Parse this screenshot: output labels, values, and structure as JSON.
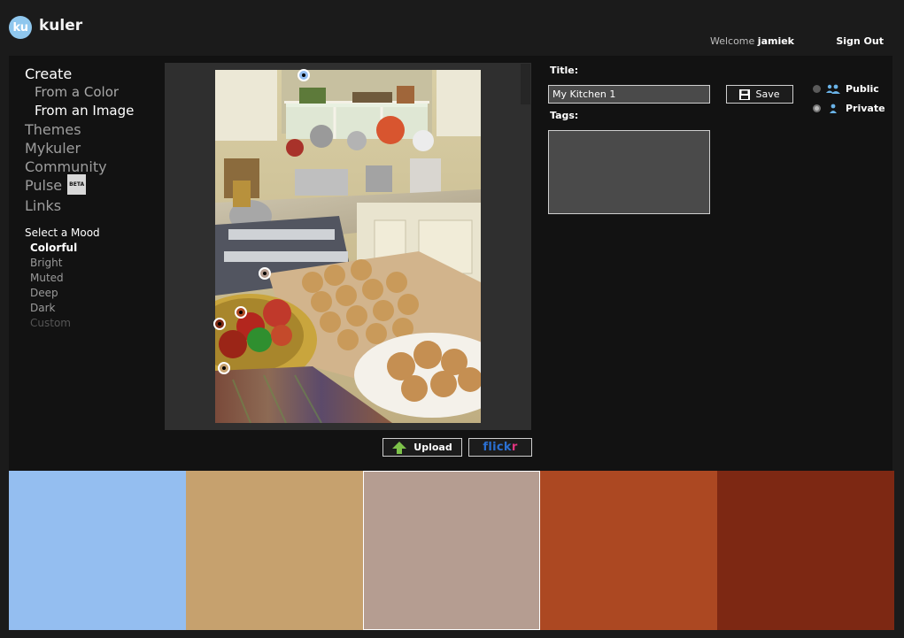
{
  "header": {
    "logo_badge": "ku",
    "logo_text": "kuler",
    "welcome_prefix": "Welcome ",
    "username": "jamiek",
    "sign_out": "Sign Out"
  },
  "nav": {
    "create": "Create",
    "from_color": "From a Color",
    "from_image": "From an Image",
    "themes": "Themes",
    "mykuler": "Mykuler",
    "community": "Community",
    "pulse": "Pulse",
    "beta": "BETA",
    "links": "Links"
  },
  "mood": {
    "title": "Select a Mood",
    "items": [
      "Colorful",
      "Bright",
      "Muted",
      "Deep",
      "Dark",
      "Custom"
    ]
  },
  "image_buttons": {
    "upload": "Upload",
    "flickr_main": "flick",
    "flickr_r": "r"
  },
  "form": {
    "title_label": "Title:",
    "title_value": "My Kitchen 1",
    "tags_label": "Tags:",
    "save": "Save",
    "public": "Public",
    "private": "Private",
    "selected_visibility": "Private"
  },
  "swatches": [
    "#94bef0",
    "#c6a16e",
    "#b59d91",
    "#ac4822",
    "#7d2813"
  ],
  "selected_swatch_index": 2,
  "icons": [
    "save-disk-icon",
    "upload-arrow-icon",
    "public-group-icon",
    "private-person-icon"
  ]
}
